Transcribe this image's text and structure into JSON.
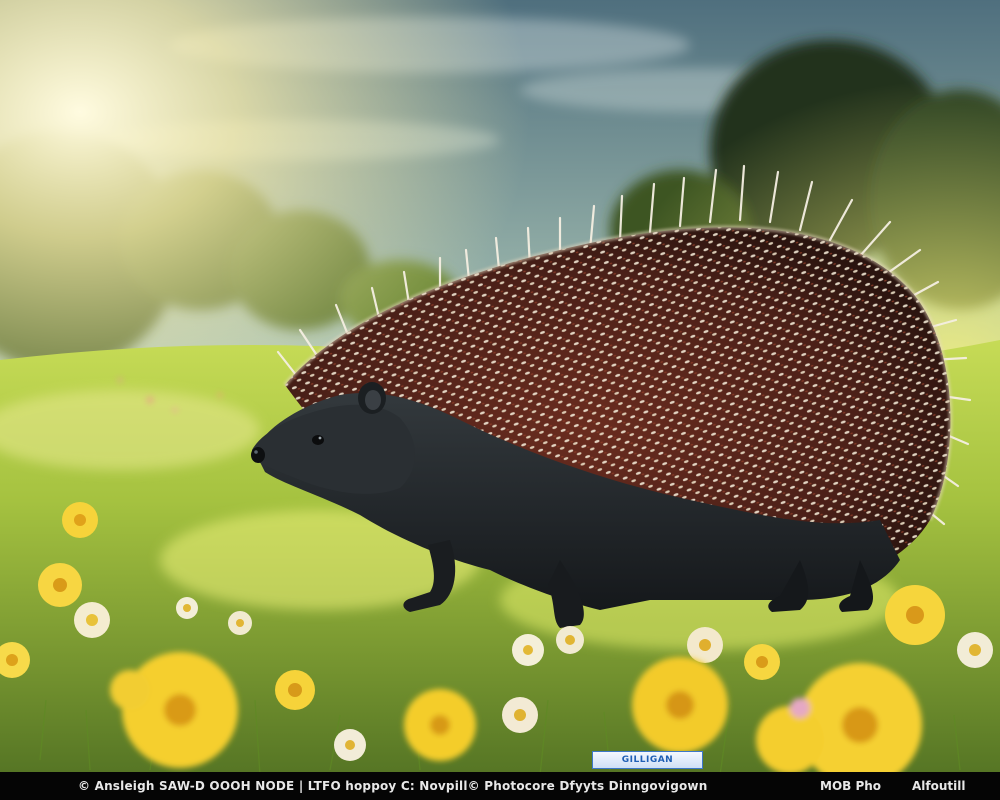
{
  "image": {
    "subject": "hedgehog-icon",
    "colors": {
      "sky_top": "#5f7f8a",
      "sky_bottom": "#c9dfa6",
      "sun_glow": "#fff6c8",
      "meadow": "#8fb23a",
      "meadow_light": "#d7e85a",
      "spine_base": "#5a2a1c",
      "spine_tip": "#f3ead8",
      "fur": "#1d2124",
      "flower_yellow": "#f6d33a",
      "flower_white": "#f4f1df"
    }
  },
  "watermark": {
    "badge_text": "GILLIGAN",
    "credit_left": "© Ansleigh SAW-D OOOH NODE | LTFO hoppoy C: Novpill© Photocore Dfyyts Dinngovigown",
    "credit_mid": "MOB Pho",
    "credit_right": "Alfoutill"
  }
}
